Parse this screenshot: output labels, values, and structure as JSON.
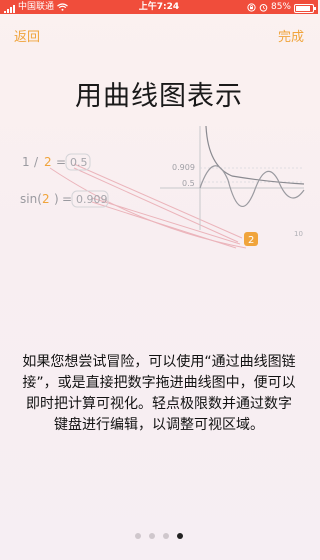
{
  "status_bar": {
    "carrier": "中国联通",
    "time": "上午7:24",
    "battery": "85%",
    "battery_level": 0.85
  },
  "nav": {
    "back_label": "返回",
    "done_label": "完成"
  },
  "title": "用曲线图表示",
  "illustration": {
    "eq1": {
      "numerator": "1",
      "slash": "/",
      "denominator": "2",
      "equals": "=",
      "result": "0.5"
    },
    "eq2": {
      "func_open": "sin(",
      "arg": "2",
      "func_close": ")",
      "equals": "=",
      "result": "0.909"
    },
    "graph_labels": {
      "y_label_1": "0.909",
      "y_label_2": "0.5",
      "x_label": "10",
      "badge": "2"
    }
  },
  "description": "如果您想尝试冒险，可以使用“通过曲线图链接”，或是直接把数字拖进曲线图中，便可以即时把计算可视化。轻点极限数并通过数字键盘进行编辑，以调整可视区域。",
  "pager": {
    "count": 4,
    "active_index": 3
  },
  "colors": {
    "accent": "#f0a43c",
    "status_bar": "#f04d3b",
    "badge": "#f0a43c"
  }
}
